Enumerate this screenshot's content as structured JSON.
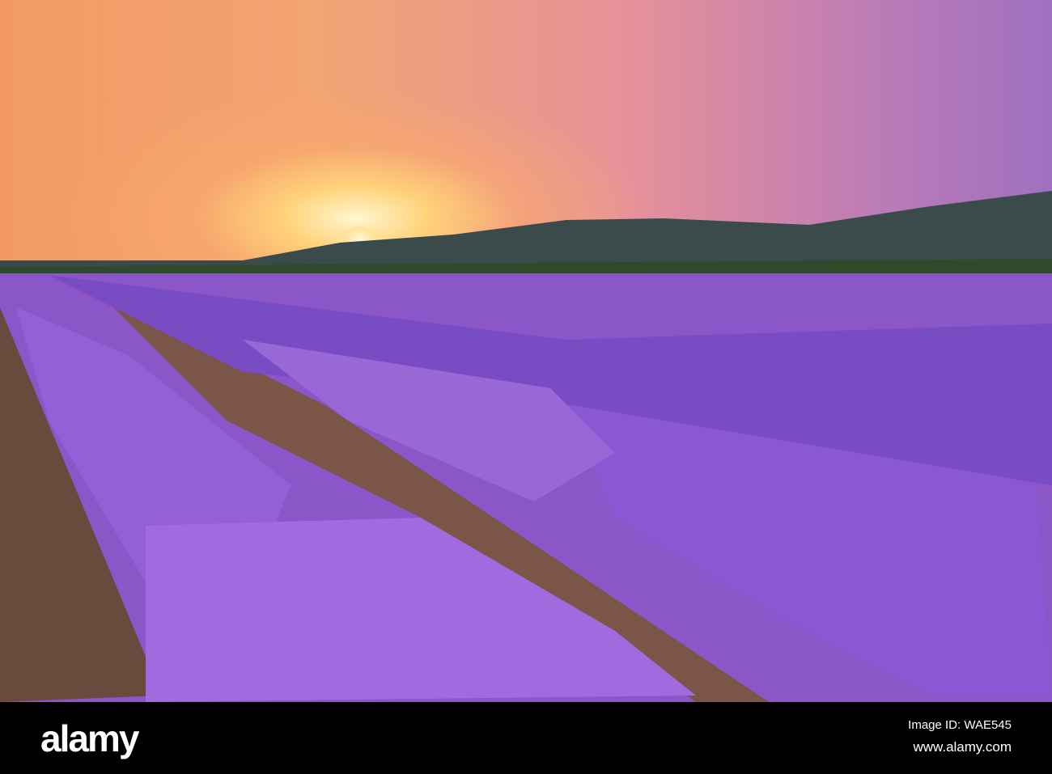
{
  "footer": {
    "logo": "alamy",
    "image_id": "Image ID: WAE545",
    "url": "www.alamy.com"
  },
  "watermark": "alamy"
}
